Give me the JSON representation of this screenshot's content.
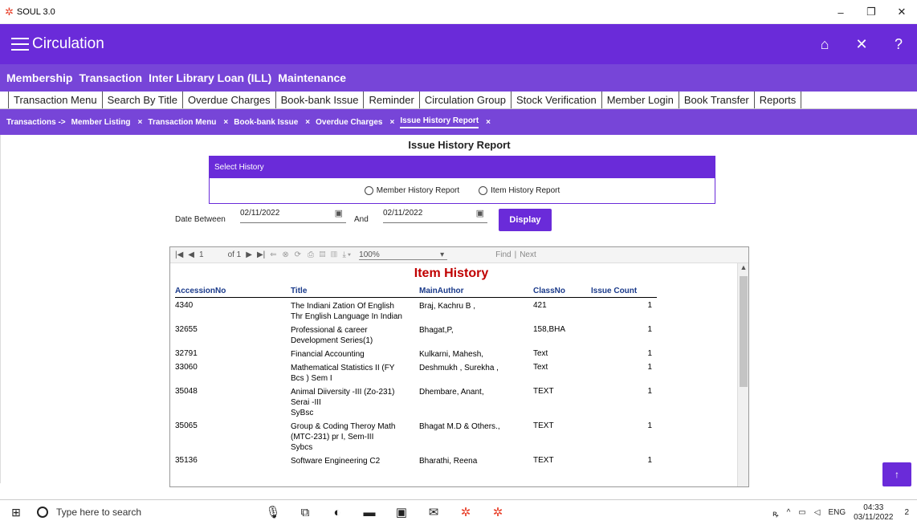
{
  "window": {
    "title": "SOUL 3.0",
    "minimize": "–",
    "maximize": "❐",
    "close": "✕"
  },
  "appbar": {
    "title": "Circulation",
    "home_icon": "⌂",
    "close_icon": "✕",
    "help_icon": "?"
  },
  "menu": {
    "items": [
      "Membership",
      "Transaction",
      "Inter Library Loan (ILL)",
      "Maintenance"
    ]
  },
  "tabs": [
    "Transaction Menu",
    "Search By Title",
    "Overdue Charges",
    "Book-bank Issue",
    "Reminder",
    "Circulation Group",
    "Stock Verification",
    "Member Login",
    "Book Transfer",
    "Reports"
  ],
  "breadcrumbs": {
    "prefix": "Transactions ->",
    "items": [
      "Member Listing",
      "Transaction Menu",
      "Book-bank Issue",
      "Overdue Charges",
      "Issue History Report"
    ],
    "close_glyph": "×"
  },
  "page": {
    "heading": "Issue History Report",
    "select_history": "Select History",
    "option_member": "Member History Report",
    "option_item": "Item History Report",
    "date_between": "Date Between",
    "from_date": "02/11/2022",
    "and_label": "And",
    "to_date": "02/11/2022",
    "display_button": "Display"
  },
  "viewer": {
    "page_current": "1",
    "page_of": "of 1",
    "zoom": "100%",
    "find": "Find",
    "next": "Next",
    "report_title": "Item History",
    "columns": [
      "AccessionNo",
      "Title",
      "MainAuthor",
      "ClassNo",
      "Issue Count"
    ],
    "rows": [
      [
        "4340",
        "The Indiani Zation Of English\nThr English Language In Indian",
        " Braj, Kachru B ,",
        "421",
        "1"
      ],
      [
        "32655",
        "Professional & career\nDevelopment Series(1)",
        "Bhagat,P,",
        "158,BHA",
        "1"
      ],
      [
        "32791",
        "Financial Accounting",
        "Kulkarni, Mahesh,",
        "Text",
        "1"
      ],
      [
        "33060",
        "Mathematical Statistics II (FY\nBcs ) Sem I",
        "Deshmukh , Surekha ,",
        "Text",
        "1"
      ],
      [
        "35048",
        "Animal Diiversity -III (Zo-231)\nSerai -III\nSyBsc",
        "Dhembare, Anant,",
        "TEXT",
        "1"
      ],
      [
        "35065",
        "Group & Coding Theroy Math\n(MTC-231) pr I, Sem-III\nSybcs",
        "Bhagat M.D & Others.,",
        "TEXT",
        "1"
      ],
      [
        "35136",
        "Software Engineering C2",
        "Bharathi, Reena",
        "TEXT",
        "1"
      ]
    ]
  },
  "taskbar": {
    "search_placeholder": "Type here to search",
    "lang": "ENG",
    "time": "04:33",
    "date": "03/11/2022",
    "notif": "2"
  }
}
